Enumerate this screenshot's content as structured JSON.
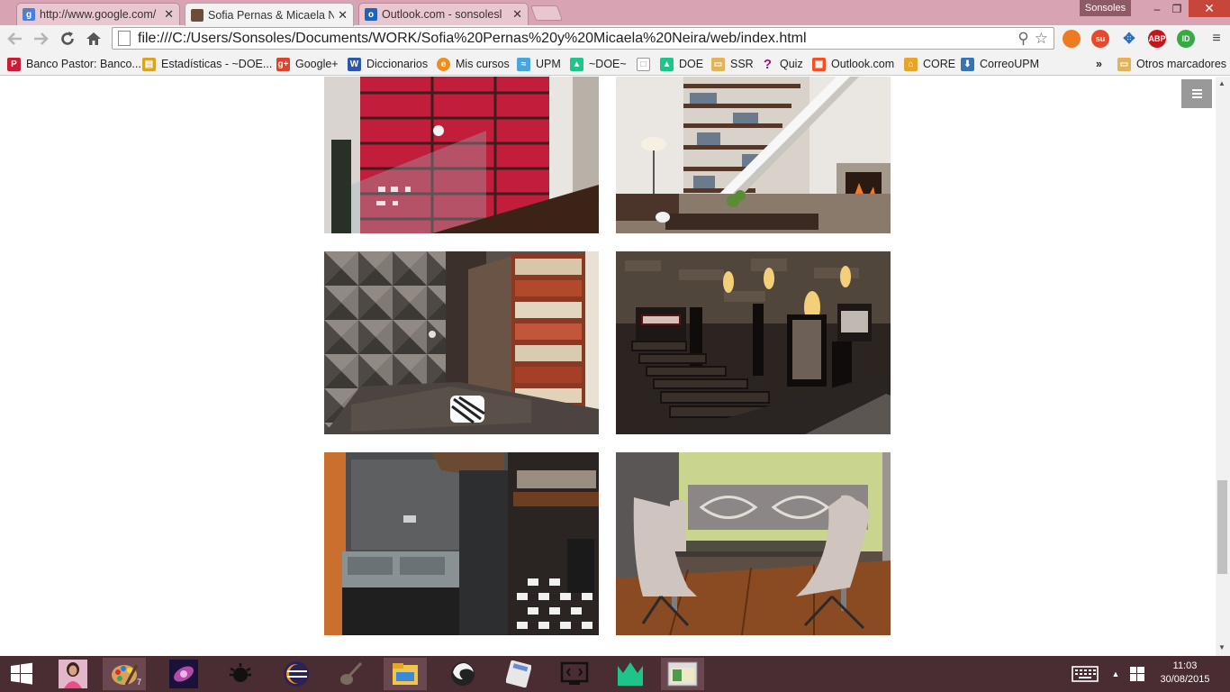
{
  "browser": {
    "tabs": [
      {
        "label": "http://www.google.com/",
        "favicon": "google-favicon",
        "color": "#4a7fdc"
      },
      {
        "label": "Sofia Pernas & Micaela Ne",
        "favicon": "photo-favicon",
        "color": "#6a4d3a"
      },
      {
        "label": "Outlook.com - sonsolesl",
        "favicon": "outlook-favicon",
        "color": "#1f64b6"
      }
    ],
    "user_badge": "Sonsoles",
    "window_controls": {
      "minimize": "–",
      "restore": "❐",
      "close": "✕"
    },
    "address": "file:///C:/Users/Sonsoles/Documents/WORK/Sofia%20Pernas%20y%20Micaela%20Neira/web/index.html",
    "nav_icons": [
      "back-icon",
      "forward-icon",
      "reload-icon",
      "home-icon"
    ],
    "extensions": [
      {
        "name": "firefox-like-extension-icon",
        "glyph": "",
        "color": "#f07a22"
      },
      {
        "name": "stumbleupon-icon",
        "glyph": "su",
        "color": "#e8492b"
      },
      {
        "name": "tools-extension-icon",
        "glyph": "",
        "color": "#2a6fb5"
      },
      {
        "name": "adblock-plus-icon",
        "glyph": "ABP",
        "color": "#c3161c"
      },
      {
        "name": "id-extension-icon",
        "glyph": "ID",
        "color": "#39a845"
      }
    ]
  },
  "bookmarks": [
    {
      "label": "Banco Pastor: Banco...",
      "icon": "P",
      "color": "#c41e3a"
    },
    {
      "label": "Estadísticas - ~DOE...",
      "icon": "▤",
      "color": "#d7a428"
    },
    {
      "label": "Google+",
      "icon": "g+",
      "color": "#d9442d"
    },
    {
      "label": "Diccionarios",
      "icon": "W",
      "color": "#2b58a8"
    },
    {
      "label": "Mis cursos",
      "icon": "e",
      "color": "#f08c1c"
    },
    {
      "label": "UPM",
      "icon": "≈",
      "color": "#4aa6d8"
    },
    {
      "label": "~DOE~",
      "icon": "▲",
      "color": "#1fc48a"
    },
    {
      "label": "",
      "icon": "□",
      "color": "#bbbbbb"
    },
    {
      "label": "DOE",
      "icon": "▲",
      "color": "#1fc48a"
    },
    {
      "label": "SSR",
      "icon": "▭",
      "color": "#e3b35a"
    },
    {
      "label": "Quiz",
      "icon": "?",
      "color": "#8b1d7a"
    },
    {
      "label": "Outlook.com",
      "icon": "▦",
      "color": "#f25022"
    },
    {
      "label": "CORE",
      "icon": "⌂",
      "color": "#e5a52b"
    },
    {
      "label": "CorreoUPM",
      "icon": "⬇",
      "color": "#3a73b3"
    }
  ],
  "bookmarks_more": "»",
  "bookmarks_other": "Otros marcadores",
  "gallery": {
    "photos": [
      {
        "name": "photo-red-bookshelf-glass-railing"
      },
      {
        "name": "photo-staircase-bookshelf-living-room"
      },
      {
        "name": "photo-pyramid-wall-bedroom-bookcase"
      },
      {
        "name": "photo-calem-wine-cellar"
      },
      {
        "name": "photo-black-glass-bathroom"
      },
      {
        "name": "photo-dining-room-chairs"
      }
    ]
  },
  "taskbar": {
    "apps": [
      "windows-start-icon",
      "user-photo-icon",
      "paint-icon",
      "nebula-icon",
      "settings-icon",
      "eclipse-icon",
      "guitar-icon",
      "file-explorer-icon",
      "firefox-icon",
      "calculator-icon",
      "terminal-icon",
      "doe-icon",
      "chrome-window-icon"
    ],
    "tray_icons": [
      "keyboard-icon",
      "show-hidden-icon",
      "windows-flag-icon"
    ],
    "time": "11:03",
    "date": "30/08/2015",
    "paint_badge": "7"
  }
}
